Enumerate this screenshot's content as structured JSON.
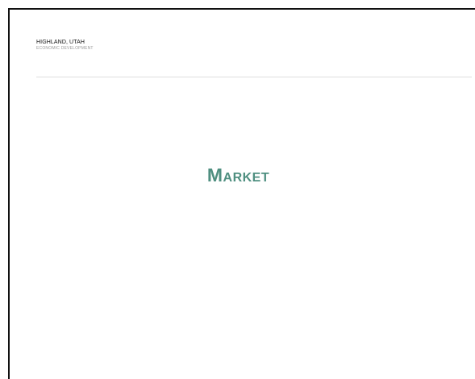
{
  "header": {
    "title": "HIGHLAND, UTAH",
    "subtitle": "ECONOMIC DEVELOPMENT"
  },
  "slide": {
    "title": "Market"
  },
  "colors": {
    "accent": "#4f8f80",
    "frame": "#111111",
    "rule": "#dedede",
    "subtitle": "#9a9a9a"
  }
}
